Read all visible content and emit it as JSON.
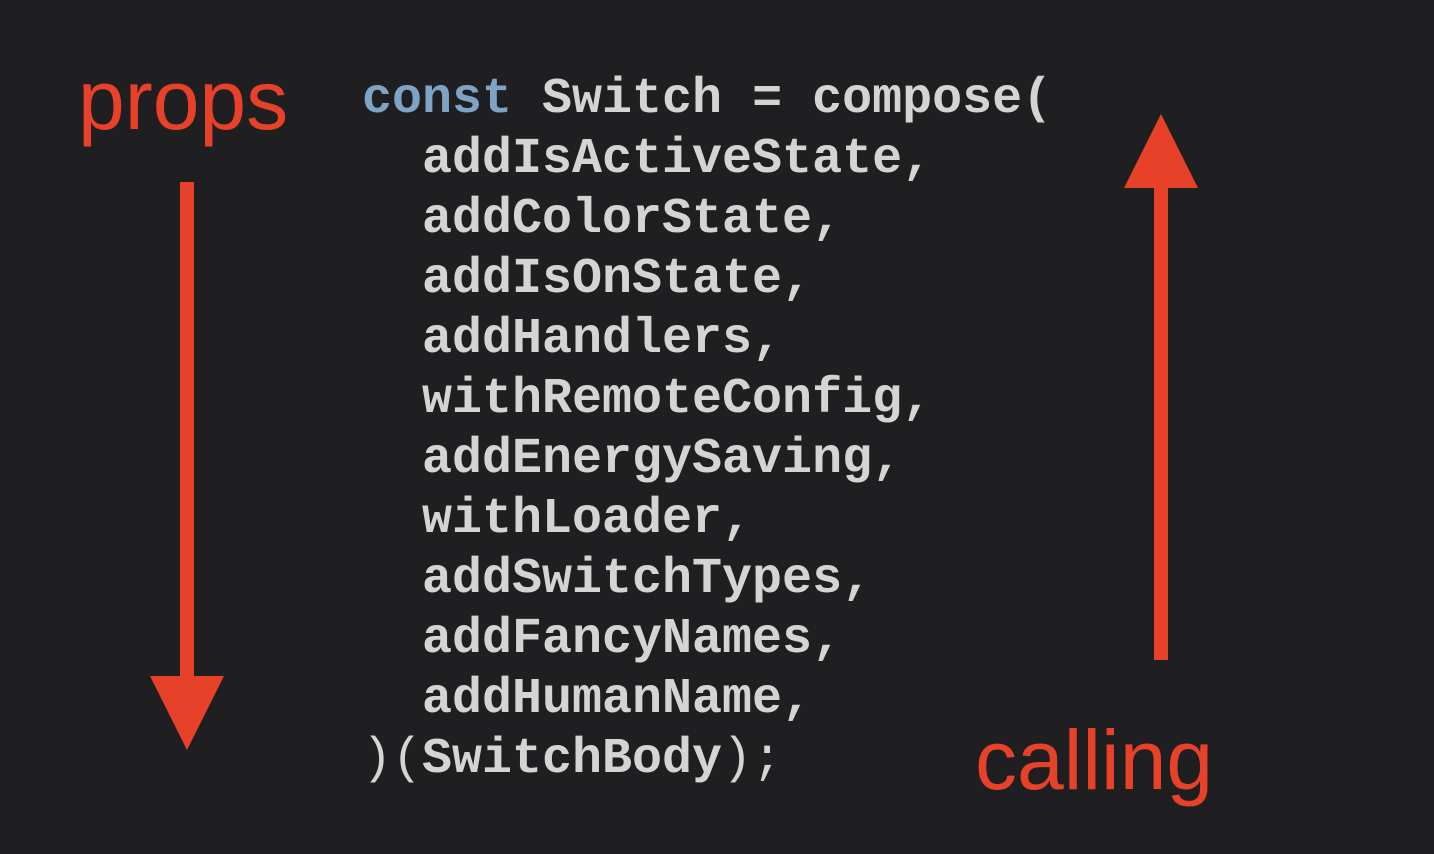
{
  "labels": {
    "left": "props",
    "right": "calling"
  },
  "code": {
    "keyword": "const",
    "declaration": " Switch = compose(",
    "args": [
      "addIsActiveState,",
      "addColorState,",
      "addIsOnState,",
      "addHandlers,",
      "withRemoteConfig,",
      "addEnergySaving,",
      "withLoader,",
      "addSwitchTypes,",
      "addFancyNames,",
      "addHumanName,"
    ],
    "closing_open": ")(",
    "closing_arg": "SwitchBody",
    "closing_end": ");"
  },
  "arrows": {
    "left": {
      "direction": "down",
      "icon": "arrow-down-icon"
    },
    "right": {
      "direction": "up",
      "icon": "arrow-up-icon"
    }
  },
  "colors": {
    "background": "#1f1f21",
    "accent": "#e8412a",
    "keyword": "#7fa3c4",
    "code": "#d4d4d4"
  }
}
